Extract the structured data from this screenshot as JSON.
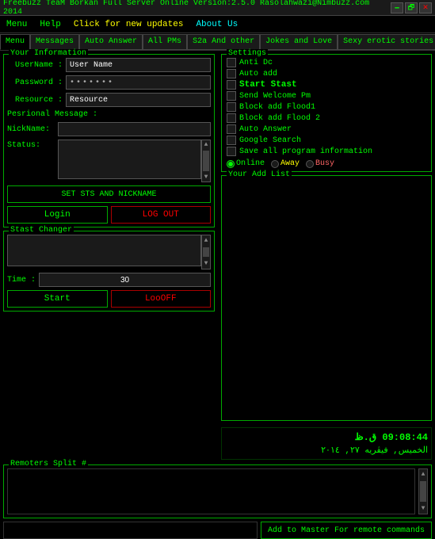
{
  "titleBar": {
    "title": "Freebuzz TeaM Borkan Full Server Online Version:2.5.0 Rasolahwazi@Nimbuzz.com 2014",
    "minimize": "🗕",
    "restore": "🗗",
    "close": "✕"
  },
  "menuBar": {
    "menu": "Menu",
    "help": "Help",
    "updates": "Click for new updates",
    "about": "About Us"
  },
  "tabs": [
    {
      "label": "Menu",
      "active": true
    },
    {
      "label": "Messages"
    },
    {
      "label": "Auto Answer"
    },
    {
      "label": "All PMs"
    },
    {
      "label": "S2a And other"
    },
    {
      "label": "Jokes and Love"
    },
    {
      "label": "Sexy erotic stories an"
    }
  ],
  "yourInfo": {
    "title": "Your Information",
    "usernameLabel": "UserName :",
    "usernamePlaceholder": "User Name",
    "usernameValue": "User Name",
    "passwordLabel": "Password :",
    "passwordValue": "•••••••",
    "resourceLabel": "Resource :",
    "resourceValue": "Resource",
    "personalMsgLabel": "Pesrional Message :",
    "nicknameLabel": "NickName:",
    "statusLabel": "Status:",
    "setBtn": "SET STS AND NICKNAME",
    "loginBtn": "Login",
    "logoutBtn": "LOG OUT"
  },
  "stastChanger": {
    "title": "Stast Changer",
    "timeLabel": "Time :",
    "timeValue": "30",
    "startBtn": "Start",
    "loooffBtn": "LooOFF"
  },
  "settings": {
    "title": "Settings",
    "checkboxes": [
      {
        "label": "Anti Dc",
        "checked": false
      },
      {
        "label": "Auto add",
        "checked": false
      },
      {
        "label": "Start Stast",
        "checked": false,
        "bold": true
      },
      {
        "label": "Send Welcome Pm",
        "checked": false
      },
      {
        "label": "Block add Flood1",
        "checked": false
      },
      {
        "label": "Block add Flood 2",
        "checked": false
      },
      {
        "label": "Auto Answer",
        "checked": false
      },
      {
        "label": "Google Search",
        "checked": false
      },
      {
        "label": "Save all program information",
        "checked": false
      }
    ],
    "radioOnline": "Online",
    "radioAway": "Away",
    "radioBusy": "Busy"
  },
  "addList": {
    "title": "Your Add List"
  },
  "timeDisplay": {
    "clock": "09:08:44 ق.ظ",
    "date": "الخميس, فيڤريه ٢٧, ٢٠١٤"
  },
  "remoters": {
    "title": "Remoters Split #"
  },
  "addMaster": {
    "inputValue": "",
    "btnLabel": "Add to Master For remote commands"
  }
}
